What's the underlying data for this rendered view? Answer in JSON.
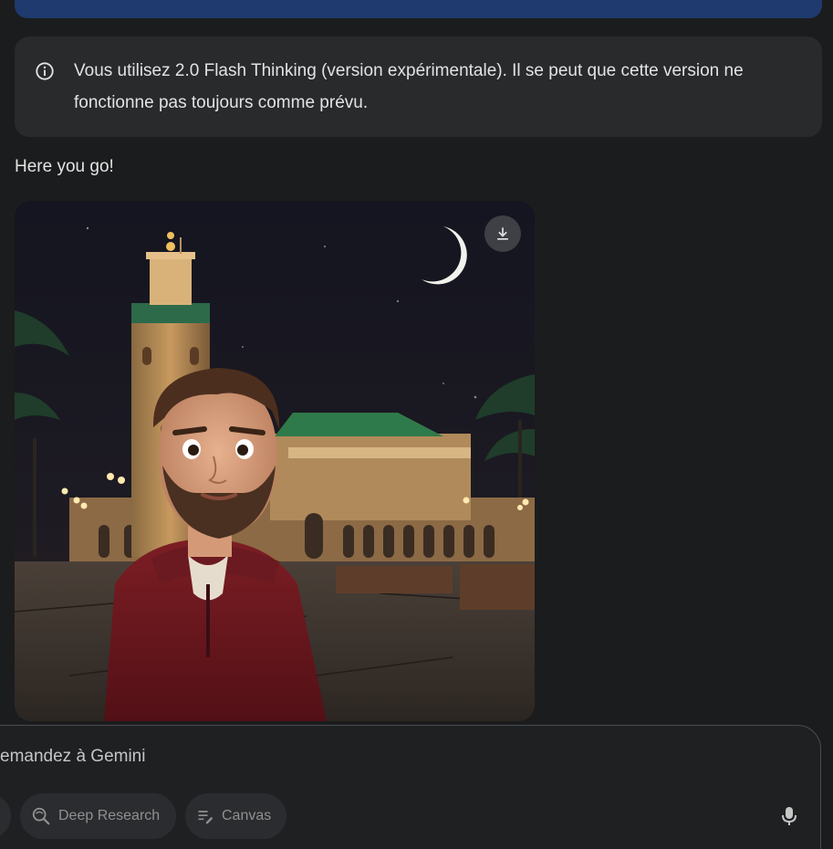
{
  "notice": {
    "icon": "info-icon",
    "text": "Vous utilisez 2.0 Flash Thinking (version expérimentale). Il se peut que cette version ne fonctionne pas toujours comme prévu."
  },
  "response": {
    "text": "Here you go!",
    "image": {
      "description_icon": "generated-image",
      "download_icon": "download-icon"
    }
  },
  "composer": {
    "placeholder": "emandez à Gemini",
    "tools": [
      {
        "label": "Deep Research",
        "icon": "deep-research-icon"
      },
      {
        "label": "Canvas",
        "icon": "canvas-icon"
      }
    ],
    "mic_icon": "mic-icon"
  },
  "colors": {
    "background": "#1b1c1d",
    "notice_bg": "#282a2c",
    "prev_bubble": "#1e3a6e",
    "chip_bg": "#2b2c2f"
  }
}
